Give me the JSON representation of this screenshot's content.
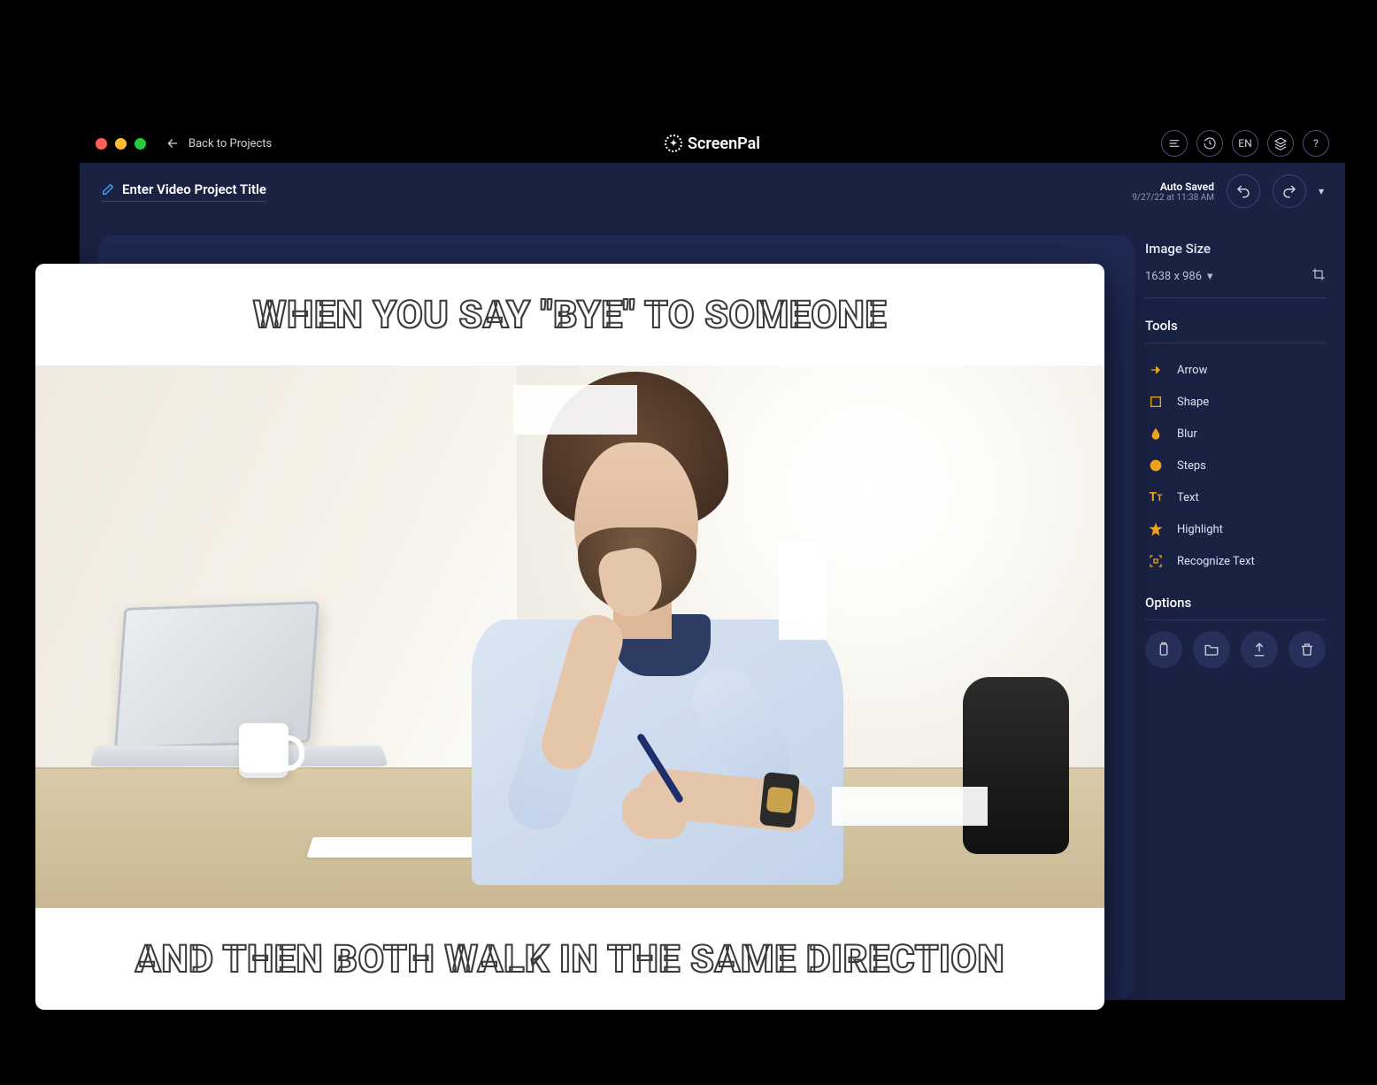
{
  "titlebar": {
    "back_label": "Back to  Projects",
    "brand": "ScreenPal",
    "lang_btn": "EN"
  },
  "subheader": {
    "title_placeholder": "Enter Video Project Title",
    "auto_saved_label": "Auto Saved",
    "auto_saved_time": "9/27/22 at 11:38 AM"
  },
  "sidebar": {
    "image_size_header": "Image Size",
    "image_size_value": "1638 x 986",
    "tools_header": "Tools",
    "tools": [
      {
        "label": "Arrow"
      },
      {
        "label": "Shape"
      },
      {
        "label": "Blur"
      },
      {
        "label": "Steps"
      },
      {
        "label": "Text"
      },
      {
        "label": "Highlight"
      },
      {
        "label": "Recognize Text"
      }
    ],
    "options_header": "Options"
  },
  "meme": {
    "top_text": "WHEN YOU SAY \"BYE\" TO SOMEONE",
    "bottom_text": "AND THEN BOTH WALK IN THE SAME DIRECTION"
  }
}
